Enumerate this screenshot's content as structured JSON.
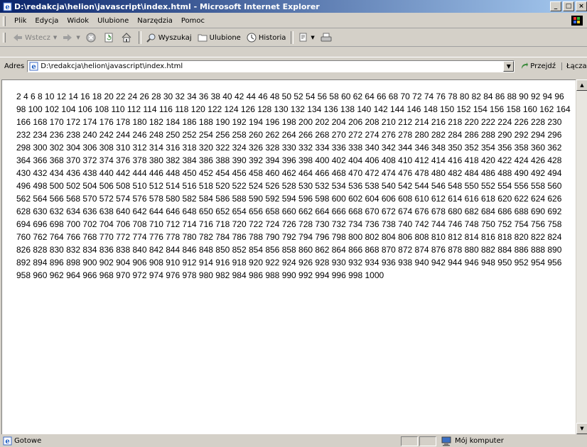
{
  "window": {
    "title": "D:\\redakcja\\helion\\javascript\\index.html - Microsoft Internet Explorer",
    "controls": {
      "minimize": "_",
      "maximize": "□",
      "close": "×"
    }
  },
  "menu": {
    "items": [
      "Plik",
      "Edycja",
      "Widok",
      "Ulubione",
      "Narzędzia",
      "Pomoc"
    ]
  },
  "toolbar": {
    "back_label": "Wstecz",
    "search_label": "Wyszukaj",
    "favorites_label": "Ulubione",
    "history_label": "Historia"
  },
  "address": {
    "label": "Adres",
    "url": "D:\\redakcja\\helion\\javascript\\index.html",
    "go_label": "Przejdź",
    "links_label": "Łącza"
  },
  "page": {
    "content": "2 4 6 8 10 12 14 16 18 20 22 24 26 28 30 32 34 36 38 40 42 44 46 48 50 52 54 56 58 60 62 64 66 68 70 72 74 76 78 80 82 84 86 88 90 92 94 96 98 100 102 104 106 108 110 112 114 116 118 120 122 124 126 128 130 132 134 136 138 140 142 144 146 148 150 152 154 156 158 160 162 164 166 168 170 172 174 176 178 180 182 184 186 188 190 192 194 196 198 200 202 204 206 208 210 212 214 216 218 220 222 224 226 228 230 232 234 236 238 240 242 244 246 248 250 252 254 256 258 260 262 264 266 268 270 272 274 276 278 280 282 284 286 288 290 292 294 296 298 300 302 304 306 308 310 312 314 316 318 320 322 324 326 328 330 332 334 336 338 340 342 344 346 348 350 352 354 356 358 360 362 364 366 368 370 372 374 376 378 380 382 384 386 388 390 392 394 396 398 400 402 404 406 408 410 412 414 416 418 420 422 424 426 428 430 432 434 436 438 440 442 444 446 448 450 452 454 456 458 460 462 464 466 468 470 472 474 476 478 480 482 484 486 488 490 492 494 496 498 500 502 504 506 508 510 512 514 516 518 520 522 524 526 528 530 532 534 536 538 540 542 544 546 548 550 552 554 556 558 560 562 564 566 568 570 572 574 576 578 580 582 584 586 588 590 592 594 596 598 600 602 604 606 608 610 612 614 616 618 620 622 624 626 628 630 632 634 636 638 640 642 644 646 648 650 652 654 656 658 660 662 664 666 668 670 672 674 676 678 680 682 684 686 688 690 692 694 696 698 700 702 704 706 708 710 712 714 716 718 720 722 724 726 728 730 732 734 736 738 740 742 744 746 748 750 752 754 756 758 760 762 764 766 768 770 772 774 776 778 780 782 784 786 788 790 792 794 796 798 800 802 804 806 808 810 812 814 816 818 820 822 824 826 828 830 832 834 836 838 840 842 844 846 848 850 852 854 856 858 860 862 864 866 868 870 872 874 876 878 880 882 884 886 888 890 892 894 896 898 900 902 904 906 908 910 912 914 916 918 920 922 924 926 928 930 932 934 936 938 940 942 944 946 948 950 952 954 956 958 960 962 964 966 968 970 972 974 976 978 980 982 984 986 988 990 992 994 996 998 1000"
  },
  "status": {
    "text": "Gotowe",
    "zone": "Mój komputer"
  },
  "icons": [
    "ie-page-icon",
    "back-arrow-icon",
    "forward-arrow-icon",
    "stop-icon",
    "refresh-icon",
    "home-icon",
    "search-icon",
    "favorites-icon",
    "history-icon",
    "mail-icon",
    "print-icon",
    "go-icon",
    "computer-icon",
    "windows-logo-icon"
  ]
}
